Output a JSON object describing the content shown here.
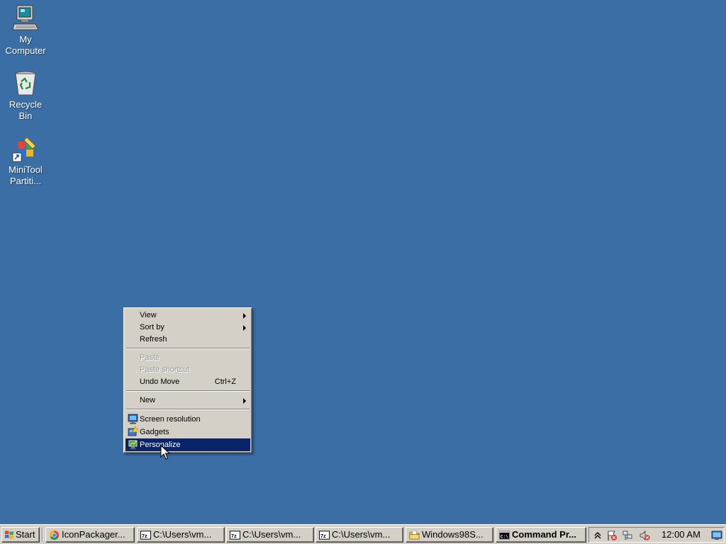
{
  "desktop": {
    "background_color": "#3a6ea5",
    "icons": [
      {
        "line1": "My",
        "line2": "Computer",
        "icon": "computer-icon"
      },
      {
        "line1": "Recycle",
        "line2": "Bin",
        "icon": "recycle-bin-icon"
      },
      {
        "line1": "MiniTool",
        "line2": "Partiti...",
        "icon": "minitool-partition-icon"
      }
    ]
  },
  "context_menu": {
    "items": {
      "view": "View",
      "sort_by": "Sort by",
      "refresh": "Refresh",
      "paste": "Paste",
      "paste_shortcut": "Paste shortcut",
      "undo_move": "Undo Move",
      "undo_shortcut": "Ctrl+Z",
      "new": "New",
      "screen_resolution": "Screen resolution",
      "gadgets": "Gadgets",
      "personalize": "Personalize"
    },
    "highlight_color": "#0a246a"
  },
  "taskbar": {
    "start_label": "Start",
    "tasks": [
      {
        "label": "IconPackager...",
        "icon": "chrome-icon"
      },
      {
        "label": "C:\\Users\\vm...",
        "icon": "7zip-icon"
      },
      {
        "label": "C:\\Users\\vm...",
        "icon": "7zip-icon"
      },
      {
        "label": "C:\\Users\\vm...",
        "icon": "7zip-icon"
      },
      {
        "label": "Windows98S...",
        "icon": "folder-icon"
      },
      {
        "label": "Command Pr...",
        "icon": "cmd-icon"
      }
    ],
    "tray": {
      "clock": "12:00 AM"
    }
  }
}
